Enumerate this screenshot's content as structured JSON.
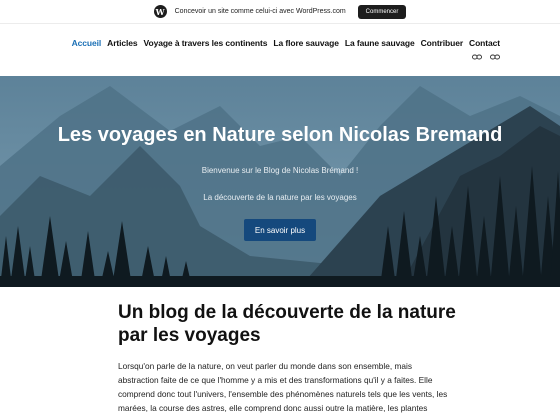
{
  "wpbar": {
    "icon": "wordpress-logo-icon",
    "text": "Concevoir un site comme celui-ci avec WordPress.com",
    "button": "Commencer"
  },
  "nav": {
    "items": [
      "Accueil",
      "Articles",
      "Voyage à travers les continents",
      "La flore sauvage",
      "La faune sauvage",
      "Contribuer",
      "Contact"
    ],
    "active_color": "#1a6fb5"
  },
  "social": {
    "icons": [
      "link-icon",
      "link-icon"
    ]
  },
  "hero": {
    "title": "Les voyages en Nature selon Nicolas Bremand",
    "subtitle1": "Bienvenue sur le Blog de Nicolas Brémand !",
    "subtitle2": "La découverte de la nature par les voyages",
    "button": "En savoir plus",
    "button_color": "#15497d"
  },
  "post": {
    "title": "Un blog de la découverte de la nature par les voyages",
    "body": "Lorsqu'on parle de la nature, on veut parler du monde dans son ensemble, mais abstraction faite de ce que l'homme y a mis et des transformations qu'il y a faites. Elle comprend donc tout l'univers, l'ensemble des phénomènes naturels tels que les vents, les marées, la course des astres, elle comprend donc aussi outre la matière, les plantes"
  }
}
